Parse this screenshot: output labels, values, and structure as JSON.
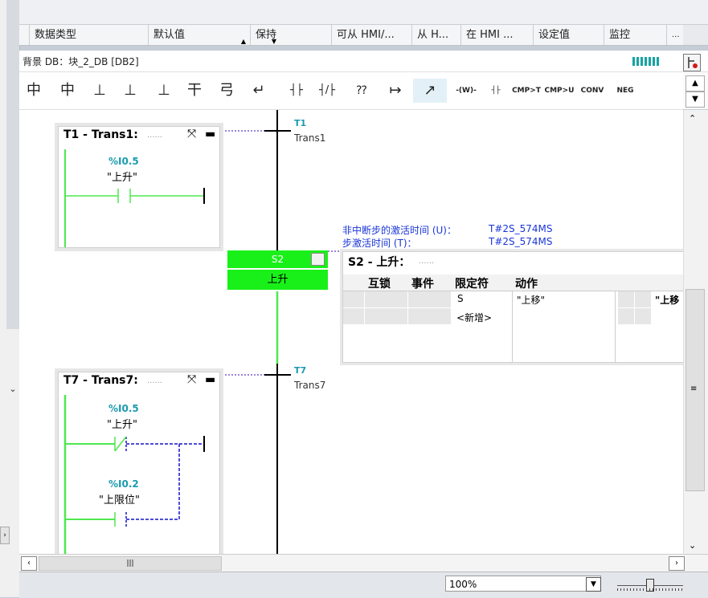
{
  "columns": [
    {
      "label": "数据类型"
    },
    {
      "label": "默认值"
    },
    {
      "label": "保持"
    },
    {
      "label": "可从 HMI/..."
    },
    {
      "label": "从 H..."
    },
    {
      "label": "在 HMI ..."
    },
    {
      "label": "设定值"
    },
    {
      "label": "监控"
    },
    {
      "label": "..."
    }
  ],
  "db_bar": {
    "label": "背景 DB：块_2_DB [DB2]"
  },
  "toolbar": {
    "items": [
      "中",
      "中",
      "⊥",
      "⊥",
      "⊥",
      "干",
      "弓",
      "↵",
      "┤├",
      "┤/├",
      "⁇",
      "↦",
      "↗",
      "-(W)-",
      "┤├",
      "CMP>T",
      "CMP>U",
      "CONV",
      "NEG"
    ]
  },
  "transitions": [
    {
      "title": "T1 - Trans1:",
      "dots": "......",
      "contacts": [
        {
          "address": "%I0.5",
          "tag": "\"上升\""
        }
      ],
      "label": "T1",
      "name": "Trans1"
    },
    {
      "title": "T7 - Trans7:",
      "dots": "......",
      "contacts": [
        {
          "address": "%I0.5",
          "tag": "\"上升\""
        },
        {
          "address": "%I0.2",
          "tag": "\"上限位\""
        }
      ],
      "label": "T7",
      "name": "Trans7"
    }
  ],
  "step": {
    "number": "S2",
    "name": "上升"
  },
  "timing": {
    "noninterrupted_label": "非中断步的激活时间 (U)：",
    "noninterrupted_value": "T#2S_574MS",
    "active_label": "步激活时间 (T)：",
    "active_value": "T#2S_574MS"
  },
  "step_detail": {
    "title": "S2 - 上升：",
    "dots": "......",
    "headers": [
      "互锁",
      "事件",
      "限定符",
      "动作"
    ],
    "row_qualifier": "S",
    "row_action": "\"上移\"",
    "row_action2": "\"上移",
    "new_entry": "<新增>"
  },
  "status": {
    "zoom": "100%"
  },
  "colors": {
    "active_step": "#19f019",
    "rung_energized": "#4fe84f",
    "rung_dashed": "#1414c8",
    "info_text": "#1a36d6"
  }
}
